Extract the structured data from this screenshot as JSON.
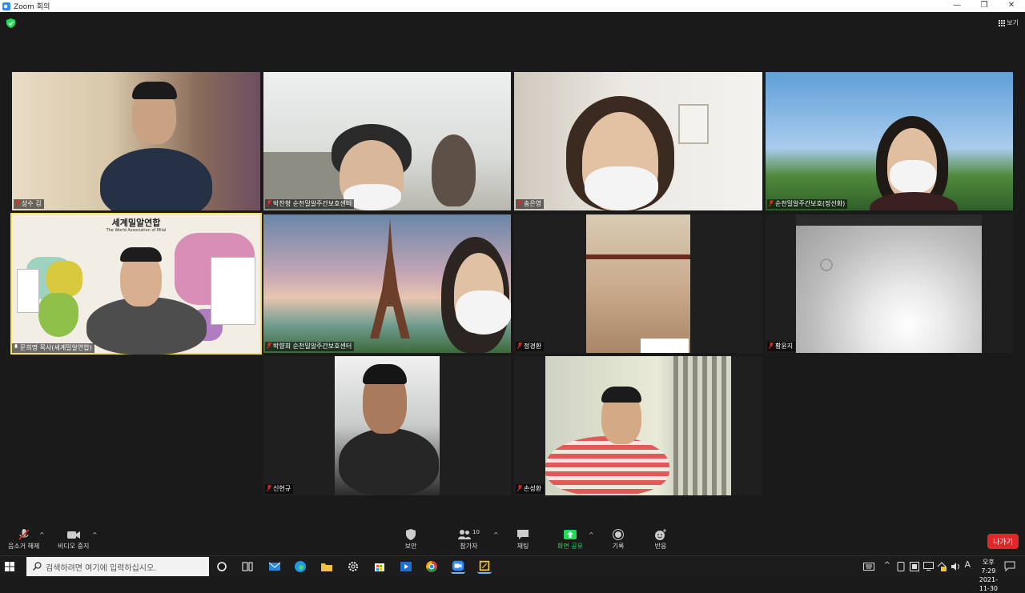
{
  "window": {
    "title": "Zoom 회의",
    "minimize": "—",
    "restore": "❐",
    "close": "✕"
  },
  "top": {
    "view_label": "보기"
  },
  "tiles": [
    {
      "name": "상수 김"
    },
    {
      "name": "박찬형 순천밀알주간보호센터"
    },
    {
      "name": "송은영"
    },
    {
      "name": "순천밀알주간보호(정선화)"
    },
    {
      "name": "문희명 목사(세계밀알연합)"
    },
    {
      "name": "박향희 순천밀알주간보호센터"
    },
    {
      "name": "정경환"
    },
    {
      "name": "황윤지"
    },
    {
      "name": "신현규"
    },
    {
      "name": "손성환"
    }
  ],
  "map_slide": {
    "title": "세계밀알연합",
    "subtitle": "The World Association of Milal"
  },
  "controls": {
    "mute_label": "음소거 해제",
    "video_label": "비디오 중지",
    "security_label": "보안",
    "participants_label": "참가자",
    "participants_count": "10",
    "chat_label": "채팅",
    "share_label": "화면 공유",
    "record_label": "기록",
    "reactions_label": "반응",
    "leave_label": "나가기",
    "caret": "^"
  },
  "taskbar": {
    "search_placeholder": "검색하려면 여기에 입력하십시오.",
    "time": "오후 7:29",
    "date": "2021-11-30",
    "ime": "A"
  },
  "colors": {
    "active_speaker": "#f6e05e",
    "leave": "#e02828",
    "share_green": "#23d959"
  }
}
